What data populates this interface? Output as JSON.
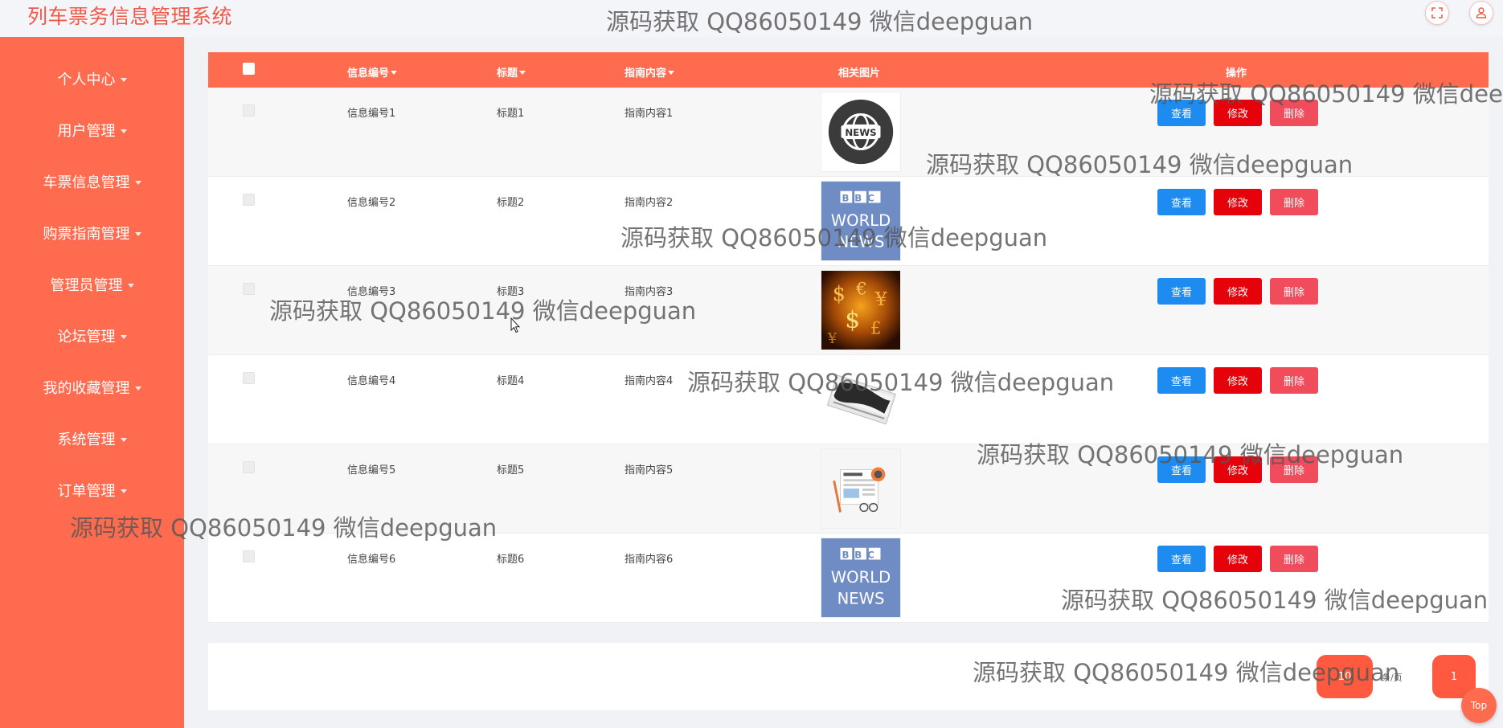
{
  "header": {
    "app_title": "列车票务信息管理系统",
    "fullscreen_icon": "fullscreen-icon",
    "user_icon": "user-icon"
  },
  "sidebar": {
    "items": [
      {
        "label": "个人中心"
      },
      {
        "label": "用户管理"
      },
      {
        "label": "车票信息管理"
      },
      {
        "label": "购票指南管理"
      },
      {
        "label": "管理员管理"
      },
      {
        "label": "论坛管理"
      },
      {
        "label": "我的收藏管理"
      },
      {
        "label": "系统管理"
      },
      {
        "label": "订单管理"
      }
    ]
  },
  "table": {
    "columns": [
      "信息编号",
      "标题",
      "指南内容",
      "相关图片",
      "操作"
    ],
    "buttons": {
      "view": "查看",
      "edit": "修改",
      "delete": "删除"
    },
    "rows": [
      {
        "code": "信息编号1",
        "title": "标题1",
        "content": "指南内容1",
        "image": "news-globe-icon"
      },
      {
        "code": "信息编号2",
        "title": "标题2",
        "content": "指南内容2",
        "image": "bbc-world-news-logo"
      },
      {
        "code": "信息编号3",
        "title": "标题3",
        "content": "指南内容3",
        "image": "currency-symbols-photo"
      },
      {
        "code": "信息编号4",
        "title": "标题4",
        "content": "指南内容4",
        "image": "news-stamp-photo"
      },
      {
        "code": "信息编号5",
        "title": "标题5",
        "content": "指南内容5",
        "image": "newspaper-illustration"
      },
      {
        "code": "信息编号6",
        "title": "标题6",
        "content": "指南内容6",
        "image": "bbc-world-news-logo"
      }
    ]
  },
  "thumb_text": {
    "news": "NEWS",
    "bbc": "BBC",
    "world": "WORLD",
    "news2": "NEWS"
  },
  "pagination": {
    "prev": "10",
    "page_size": "条/页",
    "current": "1"
  },
  "top_button": "Top",
  "watermark": "源码获取 QQ86050149 微信deepguan",
  "colors": {
    "primary": "#ff6b4e",
    "title": "#f0594a",
    "view": "#1e8bf0",
    "edit": "#e6020b",
    "delete": "#f04c5b"
  }
}
